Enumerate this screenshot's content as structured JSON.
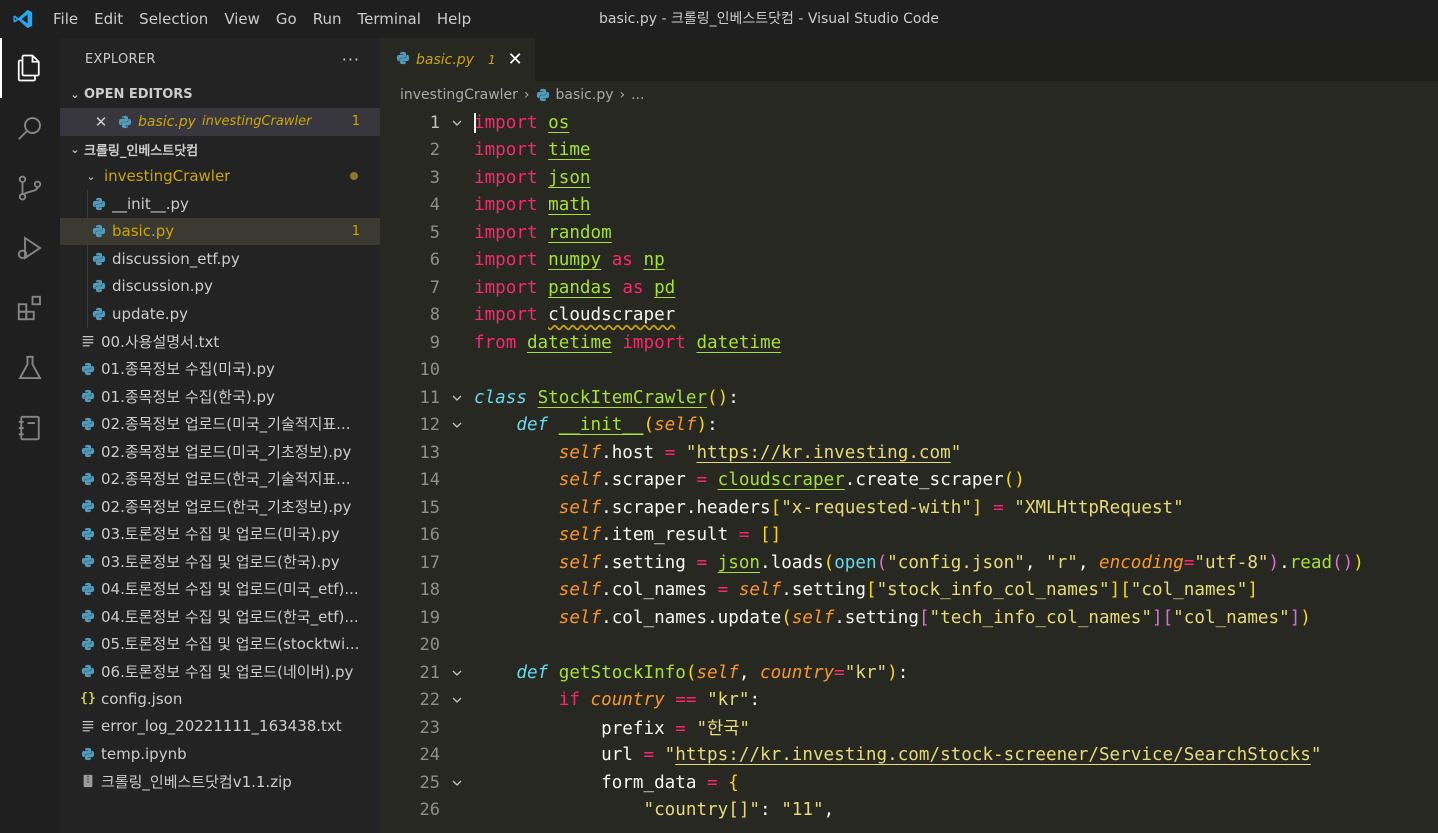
{
  "titlebar": {
    "menu": [
      "File",
      "Edit",
      "Selection",
      "View",
      "Go",
      "Run",
      "Terminal",
      "Help"
    ],
    "title": "basic.py - 크롤링_인베스트닷컴 - Visual Studio Code"
  },
  "activity": [
    "explorer-icon",
    "search-icon",
    "source-control-icon",
    "run-debug-icon",
    "extensions-icon",
    "testing-icon",
    "notebook-icon"
  ],
  "sidebar": {
    "header": "EXPLORER",
    "more": "···",
    "open_editors": {
      "label": "OPEN EDITORS",
      "items": [
        {
          "name": "basic.py",
          "path": "investingCrawler",
          "badge": "1"
        }
      ]
    },
    "workspace": {
      "label": "크롤링_인베스트닷컴",
      "folder": "investingCrawler",
      "folder_files": [
        {
          "name": "__init__.py",
          "badge": ""
        },
        {
          "name": "basic.py",
          "badge": "1"
        },
        {
          "name": "discussion_etf.py",
          "badge": ""
        },
        {
          "name": "discussion.py",
          "badge": ""
        },
        {
          "name": "update.py",
          "badge": ""
        }
      ],
      "files": [
        {
          "name": "00.사용설명서.txt",
          "icon": "txt"
        },
        {
          "name": "01.종목정보 수집(미국).py",
          "icon": "py"
        },
        {
          "name": "01.종목정보 수집(한국).py",
          "icon": "py"
        },
        {
          "name": "02.종목정보 업로드(미국_기술적지표...",
          "icon": "py"
        },
        {
          "name": "02.종목정보 업로드(미국_기초정보).py",
          "icon": "py"
        },
        {
          "name": "02.종목정보 업로드(한국_기술적지표...",
          "icon": "py"
        },
        {
          "name": "02.종목정보 업로드(한국_기초정보).py",
          "icon": "py"
        },
        {
          "name": "03.토론정보 수집 및 업로드(미국).py",
          "icon": "py"
        },
        {
          "name": "03.토론정보 수집 및 업로드(한국).py",
          "icon": "py"
        },
        {
          "name": "04.토론정보 수집 및 업로드(미국_etf)...",
          "icon": "py"
        },
        {
          "name": "04.토론정보 수집 및 업로드(한국_etf)...",
          "icon": "py"
        },
        {
          "name": "05.토론정보 수집 및 업로드(stocktwi...",
          "icon": "py"
        },
        {
          "name": "06.토론정보 수집 및 업로드(네이버).py",
          "icon": "py"
        },
        {
          "name": "config.json",
          "icon": "json"
        },
        {
          "name": "error_log_20221111_163438.txt",
          "icon": "txt"
        },
        {
          "name": "temp.ipynb",
          "icon": "py"
        },
        {
          "name": "크롤링_인베스트닷컴v1.1.zip",
          "icon": "zip"
        }
      ]
    }
  },
  "editor": {
    "tab": {
      "name": "basic.py",
      "count": "1",
      "close": "✕"
    },
    "breadcrumb": [
      "investingCrawler",
      "basic.py",
      "..."
    ],
    "lines": [
      "import os",
      "import time",
      "import json",
      "import math",
      "import random",
      "import numpy as np",
      "import pandas as pd",
      "import cloudscraper",
      "from datetime import datetime",
      "",
      "class StockItemCrawler():",
      "    def __init__(self):",
      "        self.host = \"https://kr.investing.com\"",
      "        self.scraper = cloudscraper.create_scraper()",
      "        self.scraper.headers[\"x-requested-with\"] = \"XMLHttpRequest\"",
      "        self.item_result = []",
      "        self.setting = json.loads(open(\"config.json\", \"r\", encoding=\"utf-8\").read())",
      "        self.col_names = self.setting[\"stock_info_col_names\"][\"col_names\"]",
      "        self.col_names.update(self.setting[\"tech_info_col_names\"][\"col_names\"])",
      "",
      "    def getStockInfo(self, country=\"kr\"):",
      "        if country == \"kr\":",
      "            prefix = \"한국\"",
      "            url = \"https://kr.investing.com/stock-screener/Service/SearchStocks\"",
      "            form_data = {",
      "                \"country[]\": \"11\","
    ],
    "fold_lines": [
      1,
      11,
      12,
      21,
      22,
      25
    ]
  }
}
